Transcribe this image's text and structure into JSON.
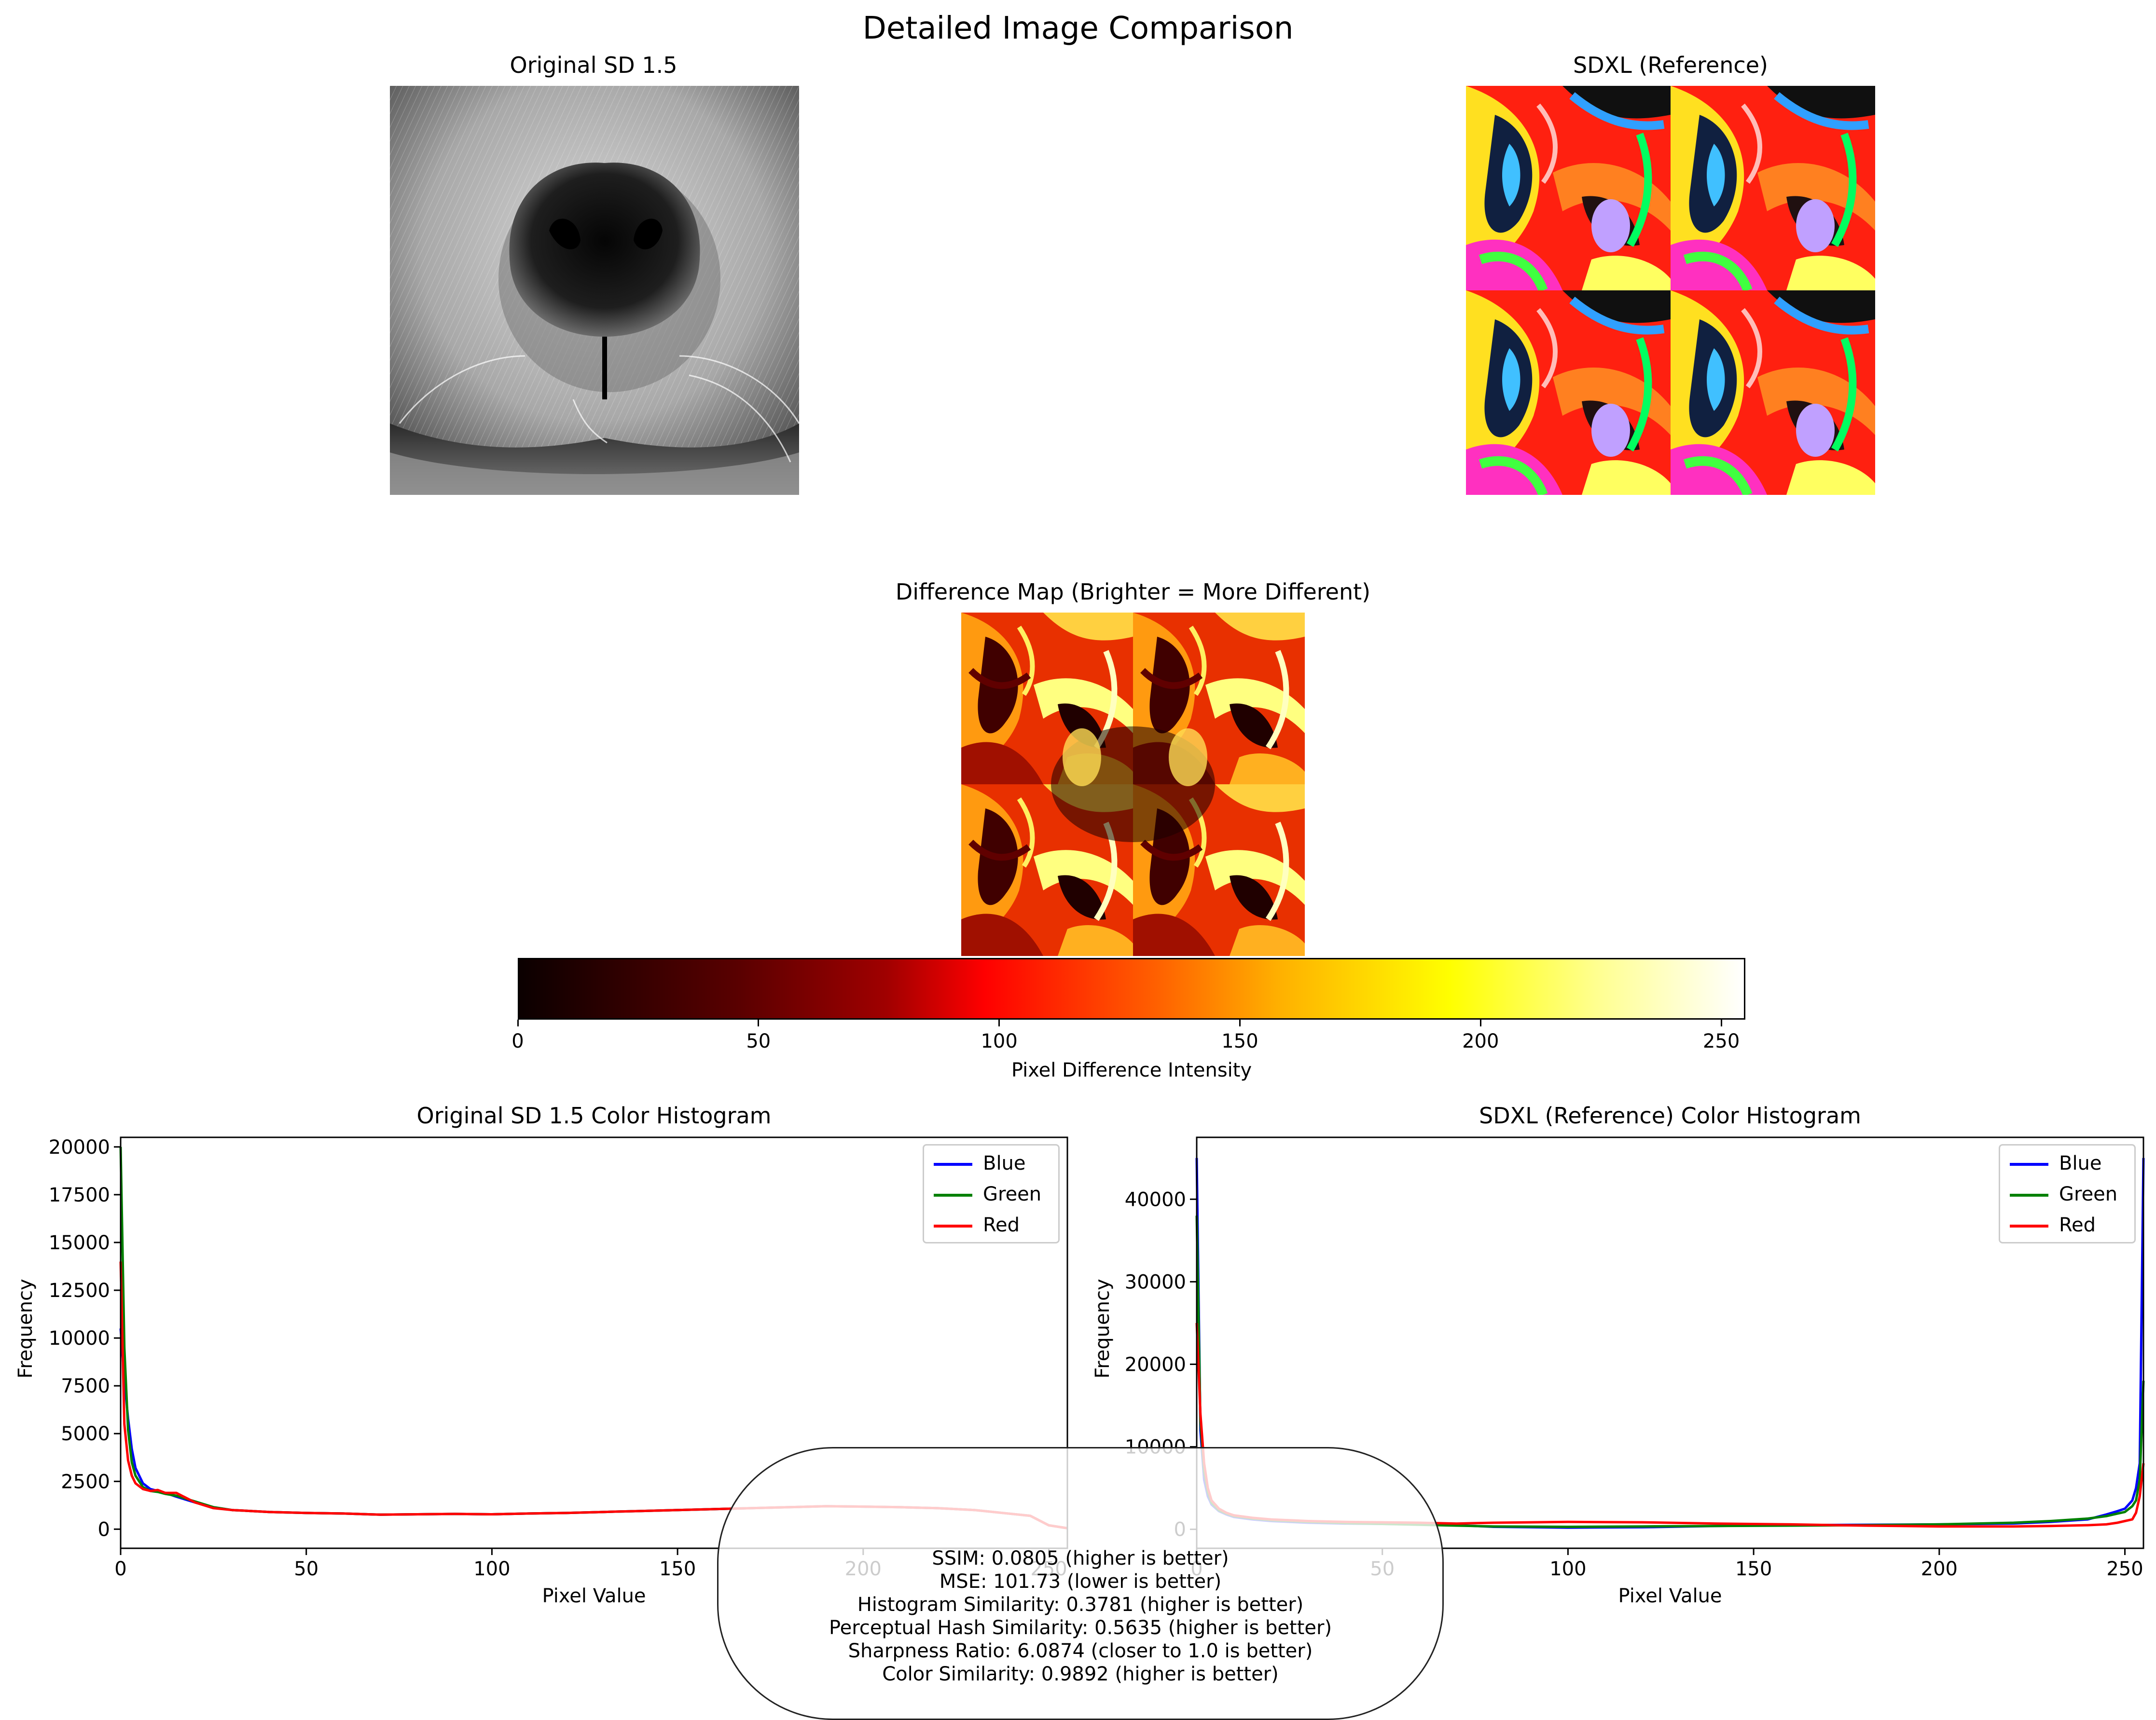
{
  "figure_title": "Detailed Image Comparison",
  "panels": {
    "original_title": "Original SD 1.5",
    "reference_title": "SDXL (Reference)",
    "diff_title": "Difference Map (Brighter = More Different)"
  },
  "colorbar": {
    "label": "Pixel Difference Intensity",
    "ticks": [
      "0",
      "50",
      "100",
      "150",
      "200",
      "250"
    ],
    "colormap": "hot",
    "range": [
      0,
      255
    ]
  },
  "metrics": [
    "SSIM: 0.0805 (higher is better)",
    "MSE: 101.73 (lower is better)",
    "Histogram Similarity: 0.3781 (higher is better)",
    "Perceptual Hash Similarity: 0.5635 (higher is better)",
    "Sharpness Ratio: 6.0874 (closer to 1.0 is better)",
    "Color Similarity: 0.9892 (higher is better)"
  ],
  "colors": {
    "blue": "#0000ff",
    "green": "#008000",
    "red": "#ff0000"
  },
  "chart_data": [
    {
      "type": "line",
      "title": "Original SD 1.5 Color Histogram",
      "xlabel": "Pixel Value",
      "ylabel": "Frequency",
      "xlim": [
        0,
        255
      ],
      "ylim": [
        -1000,
        20500
      ],
      "xticks": [
        0,
        50,
        100,
        150,
        200,
        250
      ],
      "yticks": [
        0,
        2500,
        5000,
        7500,
        10000,
        12500,
        15000,
        17500,
        20000
      ],
      "legend": "top-right",
      "series": [
        {
          "name": "Blue",
          "color": "#0000ff",
          "x": [
            0,
            1,
            2,
            3,
            4,
            6,
            8,
            10,
            12,
            15,
            20,
            25,
            30,
            40,
            50,
            60,
            70,
            80,
            90,
            100,
            110,
            120,
            130,
            140,
            150,
            160,
            170,
            180,
            190,
            200,
            210,
            220,
            230,
            240,
            245,
            250,
            255
          ],
          "values": [
            10500,
            7800,
            5800,
            4200,
            3200,
            2400,
            2100,
            2000,
            1900,
            1700,
            1400,
            1150,
            1000,
            900,
            850,
            820,
            760,
            780,
            800,
            780,
            820,
            850,
            900,
            950,
            1000,
            1050,
            1100,
            1150,
            1200,
            1180,
            1150,
            1100,
            1000,
            800,
            700,
            200,
            50
          ]
        },
        {
          "name": "Green",
          "color": "#008000",
          "x": [
            0,
            1,
            2,
            3,
            4,
            6,
            8,
            10,
            12,
            15,
            20,
            25,
            30,
            40,
            50,
            60,
            70,
            80,
            90,
            100,
            110,
            120,
            130,
            140,
            150,
            160,
            170,
            180,
            190,
            200,
            210,
            220,
            230,
            240,
            245,
            250,
            255
          ],
          "values": [
            20000,
            9500,
            5200,
            3500,
            2800,
            2200,
            2000,
            1950,
            1850,
            1750,
            1450,
            1150,
            1000,
            900,
            850,
            820,
            760,
            780,
            800,
            780,
            820,
            850,
            900,
            950,
            1000,
            1050,
            1100,
            1150,
            1200,
            1180,
            1150,
            1100,
            1000,
            800,
            700,
            200,
            50
          ]
        },
        {
          "name": "Red",
          "color": "#ff0000",
          "x": [
            0,
            1,
            2,
            3,
            4,
            6,
            8,
            10,
            12,
            15,
            20,
            25,
            30,
            40,
            50,
            60,
            70,
            80,
            90,
            100,
            110,
            120,
            130,
            140,
            150,
            160,
            170,
            180,
            190,
            200,
            210,
            220,
            230,
            240,
            245,
            250,
            255
          ],
          "values": [
            14000,
            5500,
            3600,
            2800,
            2400,
            2100,
            2000,
            2050,
            1900,
            1900,
            1400,
            1100,
            1000,
            900,
            850,
            820,
            760,
            780,
            800,
            780,
            820,
            850,
            900,
            950,
            1000,
            1050,
            1100,
            1150,
            1200,
            1180,
            1150,
            1100,
            1000,
            800,
            700,
            200,
            50
          ]
        }
      ]
    },
    {
      "type": "line",
      "title": "SDXL (Reference) Color Histogram",
      "xlabel": "Pixel Value",
      "ylabel": "Frequency",
      "xlim": [
        0,
        255
      ],
      "ylim": [
        -2300,
        47500
      ],
      "xticks": [
        0,
        50,
        100,
        150,
        200,
        250
      ],
      "yticks": [
        0,
        10000,
        20000,
        30000,
        40000
      ],
      "legend": "top-right",
      "series": [
        {
          "name": "Blue",
          "color": "#0000ff",
          "x": [
            0,
            1,
            2,
            3,
            4,
            6,
            8,
            10,
            15,
            20,
            30,
            40,
            50,
            60,
            70,
            80,
            100,
            120,
            140,
            160,
            180,
            200,
            220,
            230,
            240,
            245,
            248,
            250,
            252,
            253,
            254,
            255
          ],
          "values": [
            45000,
            12000,
            6000,
            4000,
            3000,
            2200,
            1800,
            1500,
            1200,
            1000,
            800,
            700,
            650,
            600,
            500,
            300,
            200,
            250,
            400,
            500,
            550,
            600,
            700,
            900,
            1200,
            1800,
            2200,
            2500,
            3500,
            5000,
            8000,
            45000
          ]
        },
        {
          "name": "Green",
          "color": "#008000",
          "x": [
            0,
            1,
            2,
            3,
            4,
            6,
            8,
            10,
            15,
            20,
            30,
            40,
            50,
            60,
            70,
            80,
            100,
            120,
            140,
            160,
            180,
            200,
            220,
            230,
            240,
            245,
            248,
            250,
            252,
            253,
            254,
            255
          ],
          "values": [
            38000,
            13000,
            7000,
            4500,
            3200,
            2300,
            1900,
            1600,
            1300,
            1100,
            900,
            750,
            650,
            550,
            450,
            350,
            300,
            350,
            400,
            450,
            500,
            600,
            800,
            1000,
            1300,
            1600,
            1900,
            2100,
            2800,
            3500,
            6000,
            18000
          ]
        },
        {
          "name": "Red",
          "color": "#ff0000",
          "x": [
            0,
            1,
            2,
            3,
            4,
            6,
            8,
            10,
            15,
            20,
            30,
            40,
            50,
            60,
            70,
            80,
            100,
            120,
            140,
            160,
            180,
            200,
            220,
            230,
            240,
            245,
            248,
            250,
            252,
            253,
            254,
            255
          ],
          "values": [
            25000,
            14000,
            8000,
            5000,
            3500,
            2500,
            2000,
            1700,
            1400,
            1200,
            1000,
            900,
            850,
            800,
            700,
            800,
            900,
            850,
            700,
            600,
            450,
            350,
            350,
            400,
            500,
            600,
            800,
            1000,
            1200,
            2000,
            4000,
            8000
          ]
        }
      ]
    }
  ]
}
